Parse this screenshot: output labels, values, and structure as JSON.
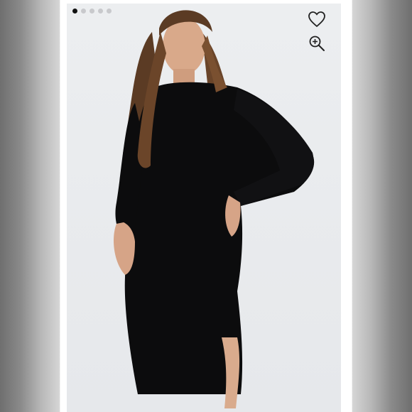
{
  "gallery": {
    "slide_count": 5,
    "active_slide": 1,
    "colors": {
      "active_dot": "#111111",
      "inactive_dot": "#c8c9cc",
      "dress": "#0c0c0d",
      "backdrop": "#e8eaec"
    }
  },
  "actions": {
    "favorite_icon": "heart-icon",
    "zoom_icon": "zoom-in-icon"
  }
}
